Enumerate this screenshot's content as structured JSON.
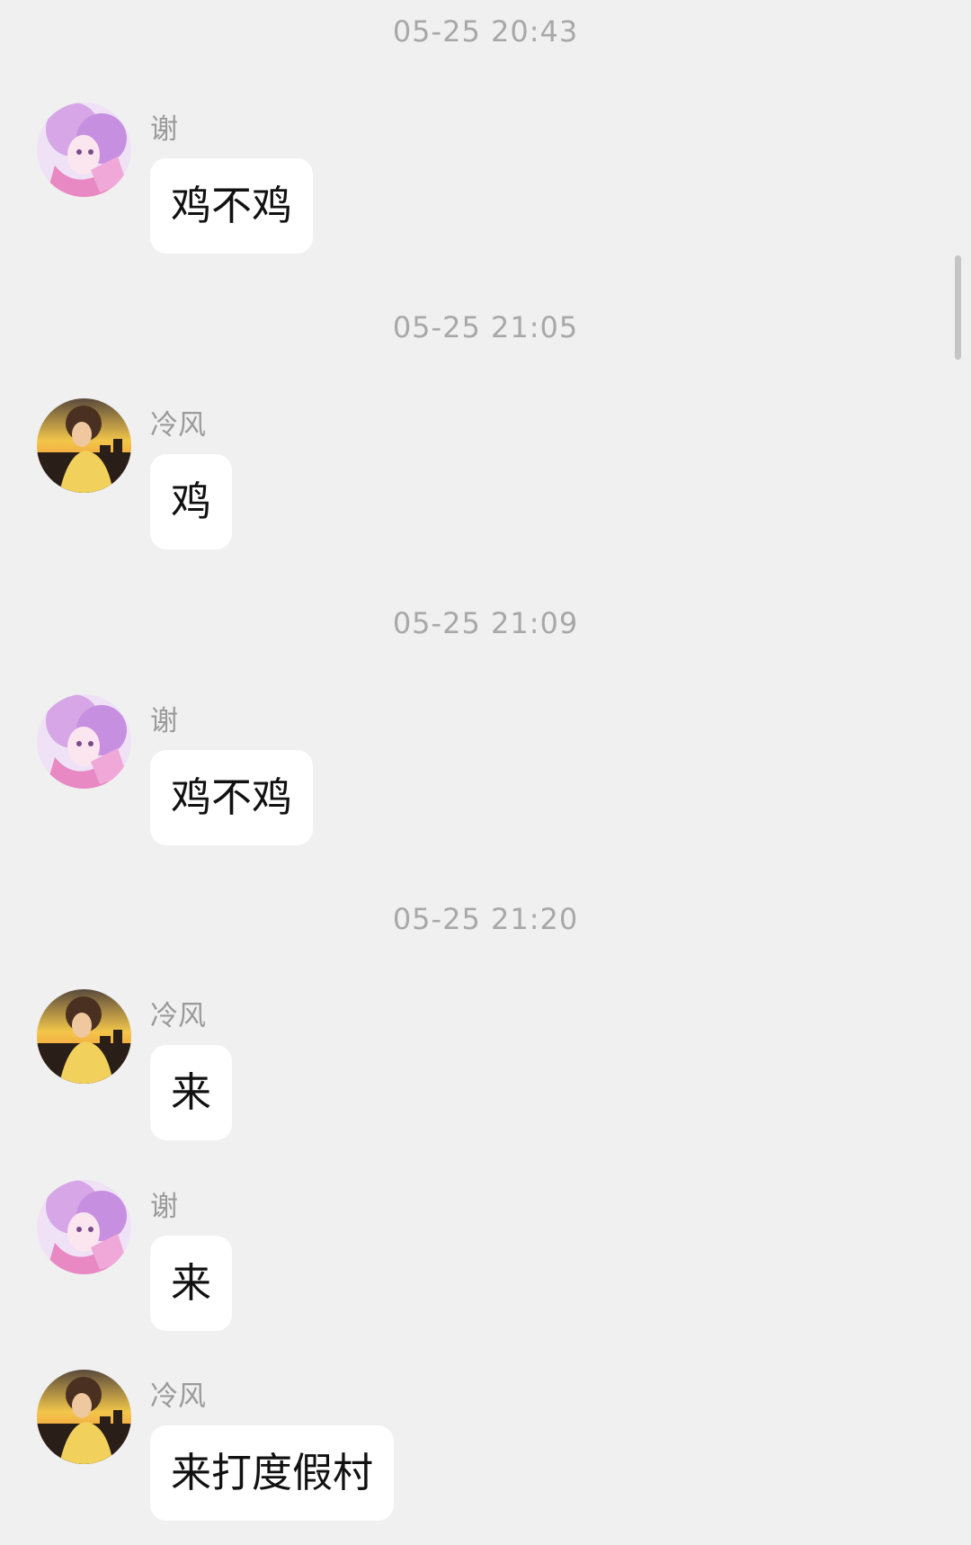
{
  "timestamps": [
    "05-25 20:43",
    "05-25 21:05",
    "05-25 21:09",
    "05-25 21:20"
  ],
  "messages": [
    {
      "sender": "谢",
      "text": "鸡不鸡",
      "avatar": "anime-girl-pink-avatar"
    },
    {
      "sender": "冷风",
      "text": "鸡",
      "avatar": "sunset-boy-avatar"
    },
    {
      "sender": "谢",
      "text": "鸡不鸡",
      "avatar": "anime-girl-pink-avatar"
    },
    {
      "sender": "冷风",
      "text": "来",
      "avatar": "sunset-boy-avatar"
    },
    {
      "sender": "谢",
      "text": "来",
      "avatar": "anime-girl-pink-avatar"
    },
    {
      "sender": "冷风",
      "text": "来打度假村",
      "avatar": "sunset-boy-avatar"
    }
  ],
  "colors": {
    "background": "#f0f0f0",
    "bubble": "#ffffff",
    "timestamp": "#a8a8a8",
    "sender": "#9a9a9a"
  }
}
